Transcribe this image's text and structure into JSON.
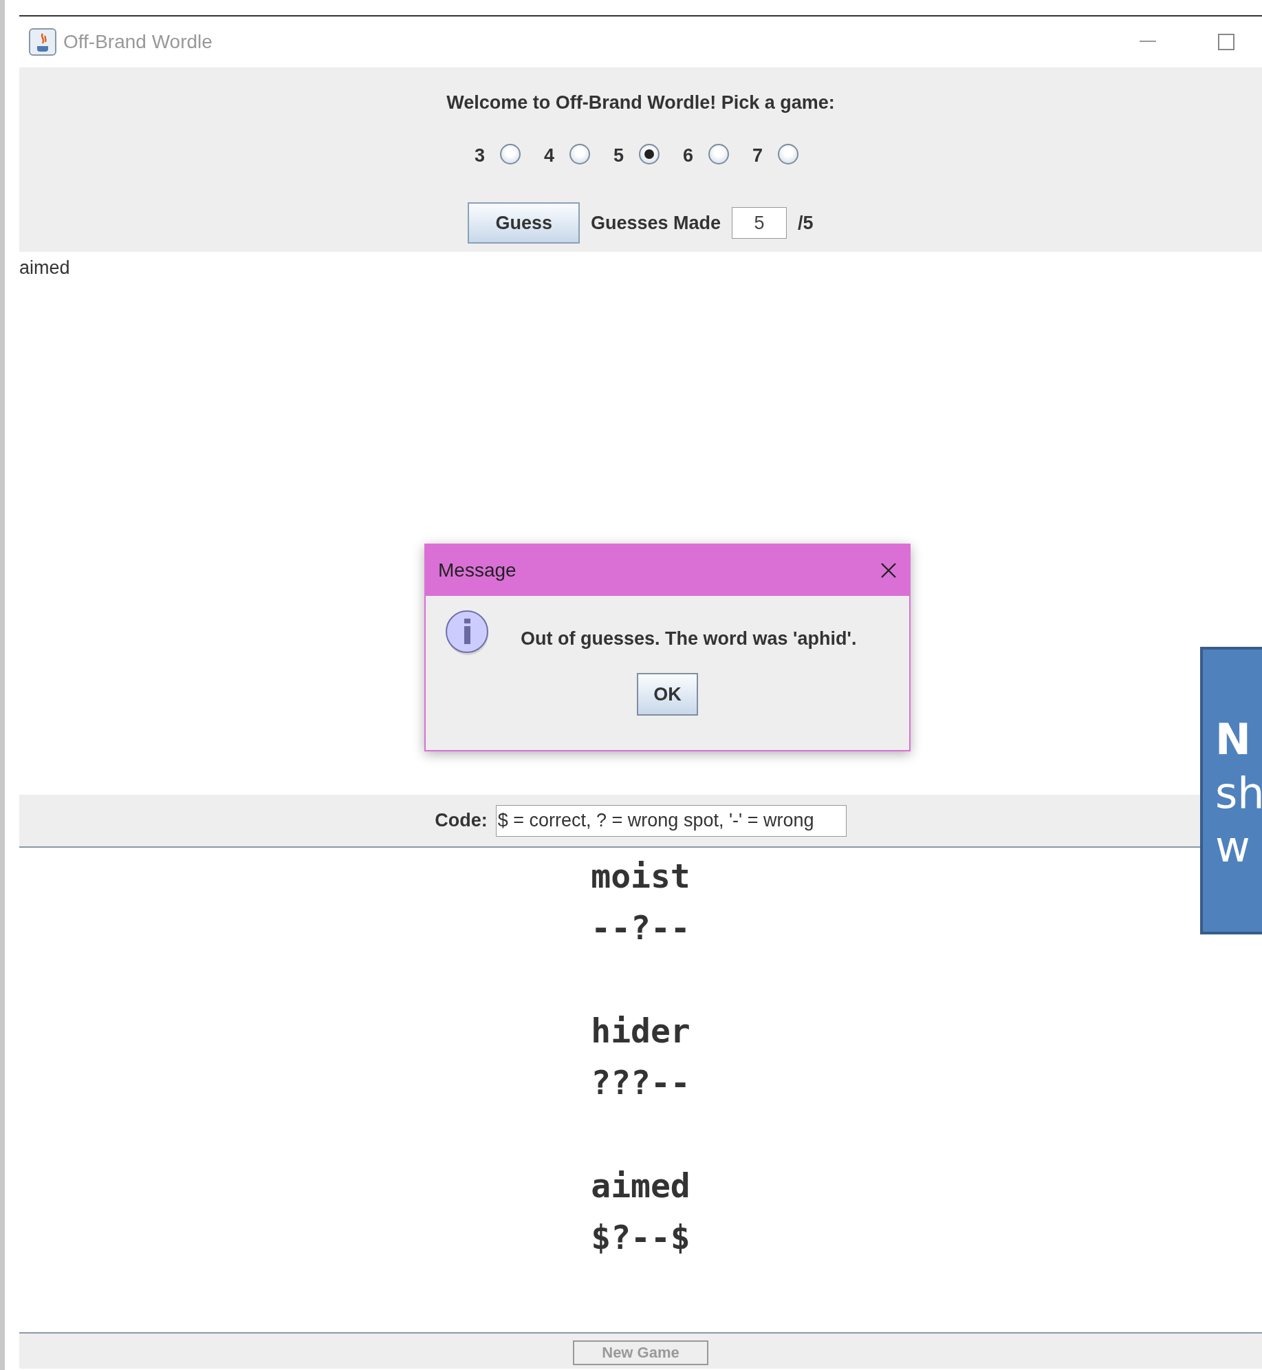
{
  "window": {
    "title": "Off-Brand Wordle"
  },
  "header": {
    "prompt": "Welcome to Off-Brand Wordle! Pick a game:",
    "options": [
      {
        "label": "3",
        "selected": false
      },
      {
        "label": "4",
        "selected": false
      },
      {
        "label": "5",
        "selected": true
      },
      {
        "label": "6",
        "selected": false
      },
      {
        "label": "7",
        "selected": false
      }
    ],
    "guess_button": "Guess",
    "guesses_label": "Guesses Made",
    "guesses_value": "5",
    "guesses_total": "/5"
  },
  "last_guess": "aimed",
  "code": {
    "label": "Code:",
    "value": "$ = correct, ? = wrong spot, '-' = wrong"
  },
  "results": [
    {
      "word": "moist",
      "code": "--?--"
    },
    {
      "word": "hider",
      "code": "???--"
    },
    {
      "word": "aimed",
      "code": "$?--$"
    }
  ],
  "new_game_button": {
    "label": "New Game",
    "disabled": true
  },
  "dialog": {
    "title": "Message",
    "message": "Out of guesses. The word was 'aphid'.",
    "ok_button": "OK"
  },
  "callout": {
    "lines": [
      {
        "text": "N",
        "bold": true
      },
      {
        "text": "sh",
        "bold": false
      },
      {
        "text": "w",
        "bold": false
      }
    ]
  }
}
